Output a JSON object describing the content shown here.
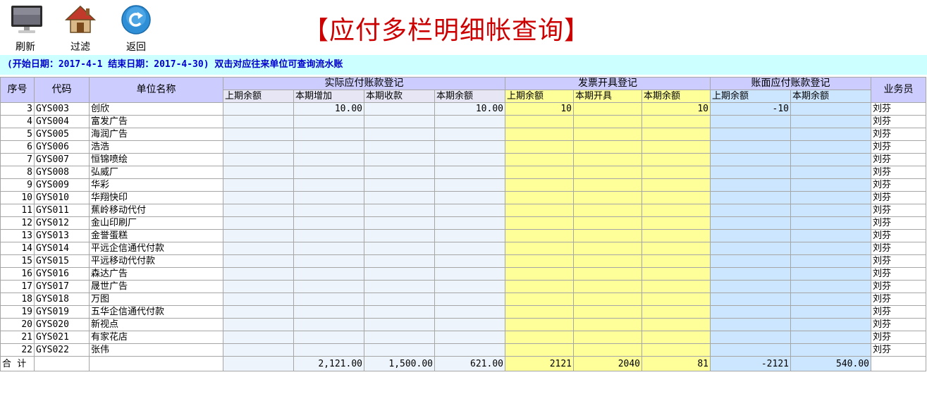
{
  "toolbar": {
    "refresh_label": "刷新",
    "filter_label": "过滤",
    "back_label": "返回"
  },
  "page_title": "【应付多栏明细帐查询】",
  "info_text": "(开始日期：2017-4-1  结束日期：2017-4-30) 双击对应往来单位可查询流水账",
  "headers": {
    "seq": "序号",
    "code": "代码",
    "name": "单位名称",
    "group_actual": "实际应付账款登记",
    "group_invoice": "发票开具登记",
    "group_book": "账面应付账款登记",
    "staff": "业务员",
    "actual_sub": [
      "上期余额",
      "本期增加",
      "本期收款",
      "本期余额"
    ],
    "invoice_sub": [
      "上期余额",
      "本期开具",
      "本期余额"
    ],
    "book_sub": [
      "上期余额",
      "本期余额"
    ]
  },
  "rows": [
    {
      "seq": "3",
      "code": "GYS003",
      "name": "创欣",
      "c1": "",
      "c2": "10.00",
      "c3": "",
      "c4": "10.00",
      "c5": "10",
      "c6": "",
      "c7": "10",
      "c8": "-10",
      "c9": "",
      "staff": "刘芬"
    },
    {
      "seq": "4",
      "code": "GYS004",
      "name": "富发广告",
      "c1": "",
      "c2": "",
      "c3": "",
      "c4": "",
      "c5": "",
      "c6": "",
      "c7": "",
      "c8": "",
      "c9": "",
      "staff": "刘芬"
    },
    {
      "seq": "5",
      "code": "GYS005",
      "name": "海润广告",
      "c1": "",
      "c2": "",
      "c3": "",
      "c4": "",
      "c5": "",
      "c6": "",
      "c7": "",
      "c8": "",
      "c9": "",
      "staff": "刘芬"
    },
    {
      "seq": "6",
      "code": "GYS006",
      "name": "浩浩",
      "c1": "",
      "c2": "",
      "c3": "",
      "c4": "",
      "c5": "",
      "c6": "",
      "c7": "",
      "c8": "",
      "c9": "",
      "staff": "刘芬"
    },
    {
      "seq": "7",
      "code": "GYS007",
      "name": "恒锦喷绘",
      "c1": "",
      "c2": "",
      "c3": "",
      "c4": "",
      "c5": "",
      "c6": "",
      "c7": "",
      "c8": "",
      "c9": "",
      "staff": "刘芬"
    },
    {
      "seq": "8",
      "code": "GYS008",
      "name": "弘威厂",
      "c1": "",
      "c2": "",
      "c3": "",
      "c4": "",
      "c5": "",
      "c6": "",
      "c7": "",
      "c8": "",
      "c9": "",
      "staff": "刘芬"
    },
    {
      "seq": "9",
      "code": "GYS009",
      "name": "华彩",
      "c1": "",
      "c2": "",
      "c3": "",
      "c4": "",
      "c5": "",
      "c6": "",
      "c7": "",
      "c8": "",
      "c9": "",
      "staff": "刘芬"
    },
    {
      "seq": "10",
      "code": "GYS010",
      "name": "华翔快印",
      "c1": "",
      "c2": "",
      "c3": "",
      "c4": "",
      "c5": "",
      "c6": "",
      "c7": "",
      "c8": "",
      "c9": "",
      "staff": "刘芬"
    },
    {
      "seq": "11",
      "code": "GYS011",
      "name": "蕉岭移动代付",
      "c1": "",
      "c2": "",
      "c3": "",
      "c4": "",
      "c5": "",
      "c6": "",
      "c7": "",
      "c8": "",
      "c9": "",
      "staff": "刘芬"
    },
    {
      "seq": "12",
      "code": "GYS012",
      "name": "金山印刷厂",
      "c1": "",
      "c2": "",
      "c3": "",
      "c4": "",
      "c5": "",
      "c6": "",
      "c7": "",
      "c8": "",
      "c9": "",
      "staff": "刘芬"
    },
    {
      "seq": "13",
      "code": "GYS013",
      "name": "金誉蛋糕",
      "c1": "",
      "c2": "",
      "c3": "",
      "c4": "",
      "c5": "",
      "c6": "",
      "c7": "",
      "c8": "",
      "c9": "",
      "staff": "刘芬"
    },
    {
      "seq": "14",
      "code": "GYS014",
      "name": "平远企信通代付款",
      "c1": "",
      "c2": "",
      "c3": "",
      "c4": "",
      "c5": "",
      "c6": "",
      "c7": "",
      "c8": "",
      "c9": "",
      "staff": "刘芬"
    },
    {
      "seq": "15",
      "code": "GYS015",
      "name": "平远移动代付款",
      "c1": "",
      "c2": "",
      "c3": "",
      "c4": "",
      "c5": "",
      "c6": "",
      "c7": "",
      "c8": "",
      "c9": "",
      "staff": "刘芬"
    },
    {
      "seq": "16",
      "code": "GYS016",
      "name": "森达广告",
      "c1": "",
      "c2": "",
      "c3": "",
      "c4": "",
      "c5": "",
      "c6": "",
      "c7": "",
      "c8": "",
      "c9": "",
      "staff": "刘芬"
    },
    {
      "seq": "17",
      "code": "GYS017",
      "name": "晟世广告",
      "c1": "",
      "c2": "",
      "c3": "",
      "c4": "",
      "c5": "",
      "c6": "",
      "c7": "",
      "c8": "",
      "c9": "",
      "staff": "刘芬"
    },
    {
      "seq": "18",
      "code": "GYS018",
      "name": "万图",
      "c1": "",
      "c2": "",
      "c3": "",
      "c4": "",
      "c5": "",
      "c6": "",
      "c7": "",
      "c8": "",
      "c9": "",
      "staff": "刘芬"
    },
    {
      "seq": "19",
      "code": "GYS019",
      "name": "五华企信通代付款",
      "c1": "",
      "c2": "",
      "c3": "",
      "c4": "",
      "c5": "",
      "c6": "",
      "c7": "",
      "c8": "",
      "c9": "",
      "staff": "刘芬"
    },
    {
      "seq": "20",
      "code": "GYS020",
      "name": "新视点",
      "c1": "",
      "c2": "",
      "c3": "",
      "c4": "",
      "c5": "",
      "c6": "",
      "c7": "",
      "c8": "",
      "c9": "",
      "staff": "刘芬"
    },
    {
      "seq": "21",
      "code": "GYS021",
      "name": "有家花店",
      "c1": "",
      "c2": "",
      "c3": "",
      "c4": "",
      "c5": "",
      "c6": "",
      "c7": "",
      "c8": "",
      "c9": "",
      "staff": "刘芬"
    },
    {
      "seq": "22",
      "code": "GYS022",
      "name": "张伟",
      "c1": "",
      "c2": "",
      "c3": "",
      "c4": "",
      "c5": "",
      "c6": "",
      "c7": "",
      "c8": "",
      "c9": "",
      "staff": "刘芬"
    }
  ],
  "total": {
    "label": "合  计",
    "c1": "",
    "c2": "2,121.00",
    "c3": "1,500.00",
    "c4": "621.00",
    "c5": "2121",
    "c6": "2040",
    "c7": "81",
    "c8": "-2121",
    "c9": "540.00",
    "staff": ""
  },
  "colors": {
    "title": "#cc0000",
    "info_bg": "#ccffff",
    "header_bg": "#ccccff",
    "invoice_bg": "#ffff99",
    "book_bg": "#cce6ff"
  }
}
